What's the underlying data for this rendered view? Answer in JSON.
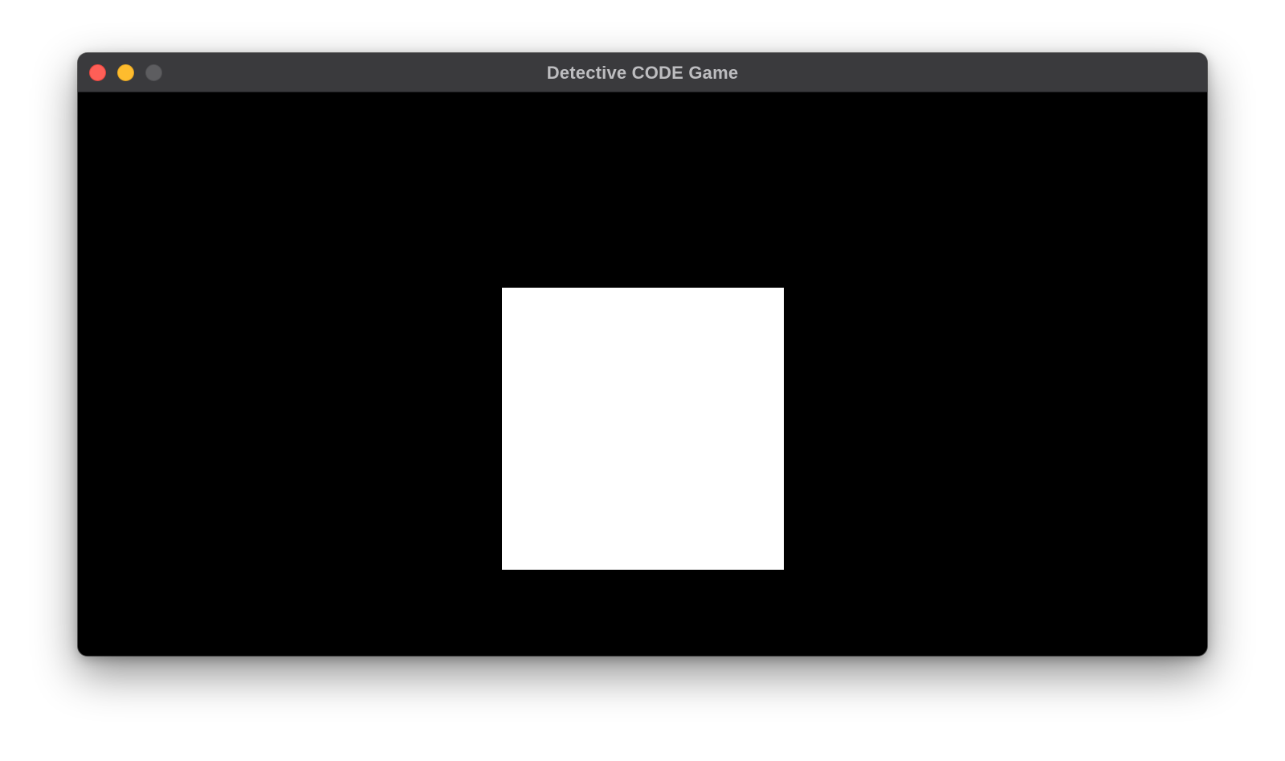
{
  "window": {
    "title": "Detective CODE Game"
  },
  "controls": {
    "close_icon": "close-icon",
    "minimize_icon": "minimize-icon",
    "zoom_icon": "zoom-icon"
  },
  "colors": {
    "titlebar_bg": "#3a3a3d",
    "title_text": "#bdbdc0",
    "content_bg": "#000000",
    "square_fill": "#ffffff",
    "close": "#ff5f57",
    "minimize": "#febc2e",
    "zoom_disabled": "#5d5d60"
  }
}
